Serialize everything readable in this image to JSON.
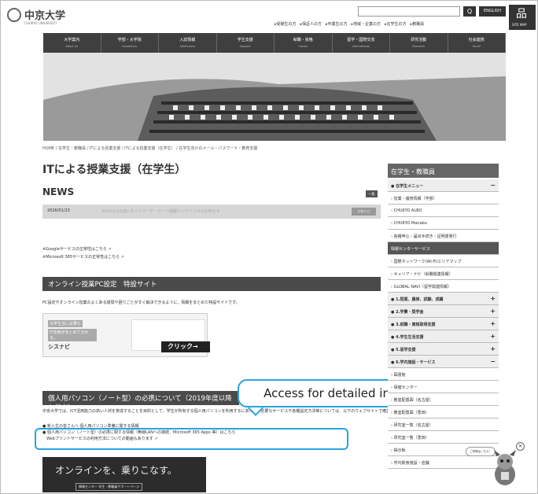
{
  "header": {
    "logo_text": "中京大学",
    "logo_sub": "CHUKYO UNIVERSITY",
    "search_placeholder": "",
    "search_button": "Q",
    "english_button": "ENGLISH",
    "sitemap_label": "SITE MAP",
    "sitemap_icon_glyph": "品",
    "utility_links": "▸受験生の方　▸保証人の方　▸卒業生の方　▸地域・企業の方　▸在学生の方　▸教職員"
  },
  "nav": [
    {
      "label": "大学案内",
      "en": "About Us"
    },
    {
      "label": "学部・大学院",
      "en": "Academics"
    },
    {
      "label": "入試情報",
      "en": "Admissions"
    },
    {
      "label": "学生支援",
      "en": "Support"
    },
    {
      "label": "就職・資格",
      "en": "Career"
    },
    {
      "label": "留学・国際交流",
      "en": "International"
    },
    {
      "label": "研究活動",
      "en": "Research"
    },
    {
      "label": "社会連携",
      "en": "Social"
    }
  ],
  "breadcrumb": "HOME / 在学生・教職員 / ITによる授業支援 / ITによる授業支援（在学生） / 在学生向けのメール・パスワード・教育支援",
  "page_title": "ITによる授業支援（在学生）",
  "news": {
    "heading": "NEWS",
    "list_button": "一覧",
    "items": [
      {
        "date": "2026/01/23",
        "text": "2026/1/30(金) ネットワーク・サーバ機器メンテナンスのお知らせ",
        "tag": "お知らせ"
      }
    ]
  },
  "service_links": [
    "※Googleサービスの正常性はこちら",
    "※Microsoft 365サービスの正常性はこちら"
  ],
  "online_section": {
    "heading": "オンライン授業PC設定　特設サイト",
    "description": "PC設定やオンライン授業のよくある疑問や困りごとがすぐ解決できるように、情報をまとめた特設サイトです。",
    "banner_line1": "大学生活に必要な",
    "banner_line2": "IT活用がまとめて分かる。",
    "banner_logo": "シスナビ",
    "banner_click": "クリック→"
  },
  "pc_section": {
    "heading": "個人用パソコン（ノート型）の必携について（2019年度以降入学者）",
    "description": "中京大学では、ICT活用能力の高い人材を育成することを目的として、学生が所有する個人用パソコンを利用するにあたって必要なサービスや各種設定方法等については、以下のウェブサイトで確認・設定できます。",
    "bullet1": "新入生の皆さんへ 個人用パソコン準備に関する情報",
    "bullet2": "個人用パソコン（ノート型）の必携に関する情報（無線LANへの接続、Microsoft 365 Apps 等）はこちら",
    "bullet3": "Webプリントサービスの利用方法についての動画もあります"
  },
  "callout_text": "Access for detailed information",
  "bottom_banner": {
    "text": "オンラインを、乗りこなす。",
    "sub": "情報センター 学生・教職員サポートページ"
  },
  "sidebar": {
    "heading": "在学生・教職員",
    "items": [
      {
        "label": "在学生メニュー",
        "kind": "grp",
        "sign": "−"
      },
      {
        "label": "授業・履修情報（学部）",
        "kind": "item",
        "sign": ""
      },
      {
        "label": "CHUKYO ALBO",
        "kind": "item",
        "sign": ""
      },
      {
        "label": "CHUKYO Manabo",
        "kind": "item",
        "sign": ""
      },
      {
        "label": "各種申込・届出手続き・証明書発行",
        "kind": "item",
        "sign": ""
      },
      {
        "label": "情報センターサービス",
        "kind": "dark",
        "sign": ""
      },
      {
        "label": "国際ネットワーク(Wi-Fi)エリアマップ",
        "kind": "item",
        "sign": ""
      },
      {
        "label": "キャリア・ナビ（就職関連情報）",
        "kind": "item",
        "sign": ""
      },
      {
        "label": "GLOBAL NAVI（留学関連情報）",
        "kind": "item",
        "sign": ""
      },
      {
        "label": "1.授業、履修、試験、成績",
        "kind": "grp",
        "sign": "+"
      },
      {
        "label": "2.学費・奨学金",
        "kind": "grp",
        "sign": "+"
      },
      {
        "label": "3.就職・資格取得支援",
        "kind": "grp",
        "sign": "+"
      },
      {
        "label": "4.学生生活支援",
        "kind": "grp",
        "sign": "+"
      },
      {
        "label": "5.留学支援",
        "kind": "grp",
        "sign": "+"
      },
      {
        "label": "6.学内施設・サービス",
        "kind": "grp",
        "sign": "−"
      },
      {
        "label": "図書館",
        "kind": "item",
        "sign": ""
      },
      {
        "label": "保健センター",
        "kind": "item",
        "sign": ""
      },
      {
        "label": "教室配置図（名古屋）",
        "kind": "item",
        "sign": ""
      },
      {
        "label": "教室配置図（豊田）",
        "kind": "item",
        "sign": ""
      },
      {
        "label": "研究室一覧（名古屋）",
        "kind": "item",
        "sign": ""
      },
      {
        "label": "研究室一覧（豊田）",
        "kind": "item",
        "sign": ""
      },
      {
        "label": "掲示板",
        "kind": "item",
        "sign": ""
      },
      {
        "label": "学内飲食施設・店舗",
        "kind": "item",
        "sign": ""
      }
    ]
  },
  "mascot_bubble": "ご質問はこちら！",
  "close_glyph": "×",
  "colors": {
    "highlight": "#2aa3e0",
    "nav_bg": "#3f3f3f"
  }
}
